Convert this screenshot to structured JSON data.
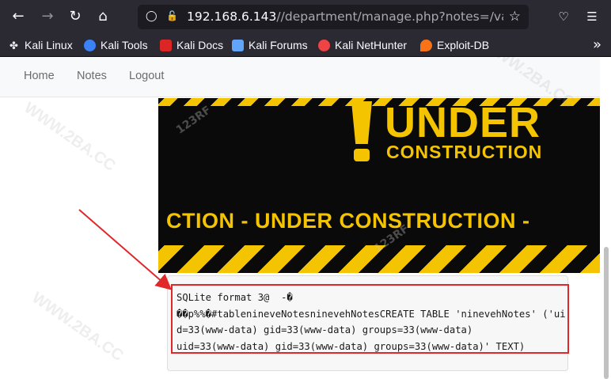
{
  "browser": {
    "url_host": "192.168.6.143",
    "url_path": "//department/manage.php?notes=/var/tmp/"
  },
  "bookmarks": [
    {
      "label": "Kali Linux",
      "icon": "kali-dragon-icon",
      "color": "#e8e8e8"
    },
    {
      "label": "Kali Tools",
      "icon": "kali-tools-icon",
      "color": "#3b82f6"
    },
    {
      "label": "Kali Docs",
      "icon": "kali-docs-icon",
      "color": "#dc2626"
    },
    {
      "label": "Kali Forums",
      "icon": "kali-forums-icon",
      "color": "#60a5fa"
    },
    {
      "label": "Kali NetHunter",
      "icon": "nethunter-icon",
      "color": "#ef4444"
    },
    {
      "label": "Exploit-DB",
      "icon": "exploit-db-icon",
      "color": "#f97316"
    }
  ],
  "nav": {
    "home": "Home",
    "notes": "Notes",
    "logout": "Logout"
  },
  "banner": {
    "under": "UNDER",
    "construction": "CONSTRUCTION",
    "band": "CTION - UNDER  CONSTRUCTION -",
    "watermark": "123RF"
  },
  "note_output": "SQLite format 3@  -�\n��p%%�#tablenineveNotesninevehNotesCREATE TABLE 'ninevehNotes' ('uid=33(www-data) gid=33(www-data) groups=33(www-data)\nuid=33(www-data) gid=33(www-data) groups=33(www-data)' TEXT)",
  "site_watermark": "WWW.2BA.CC",
  "colors": {
    "annotation_red": "#e0282a",
    "caution_yellow": "#f5c400"
  }
}
